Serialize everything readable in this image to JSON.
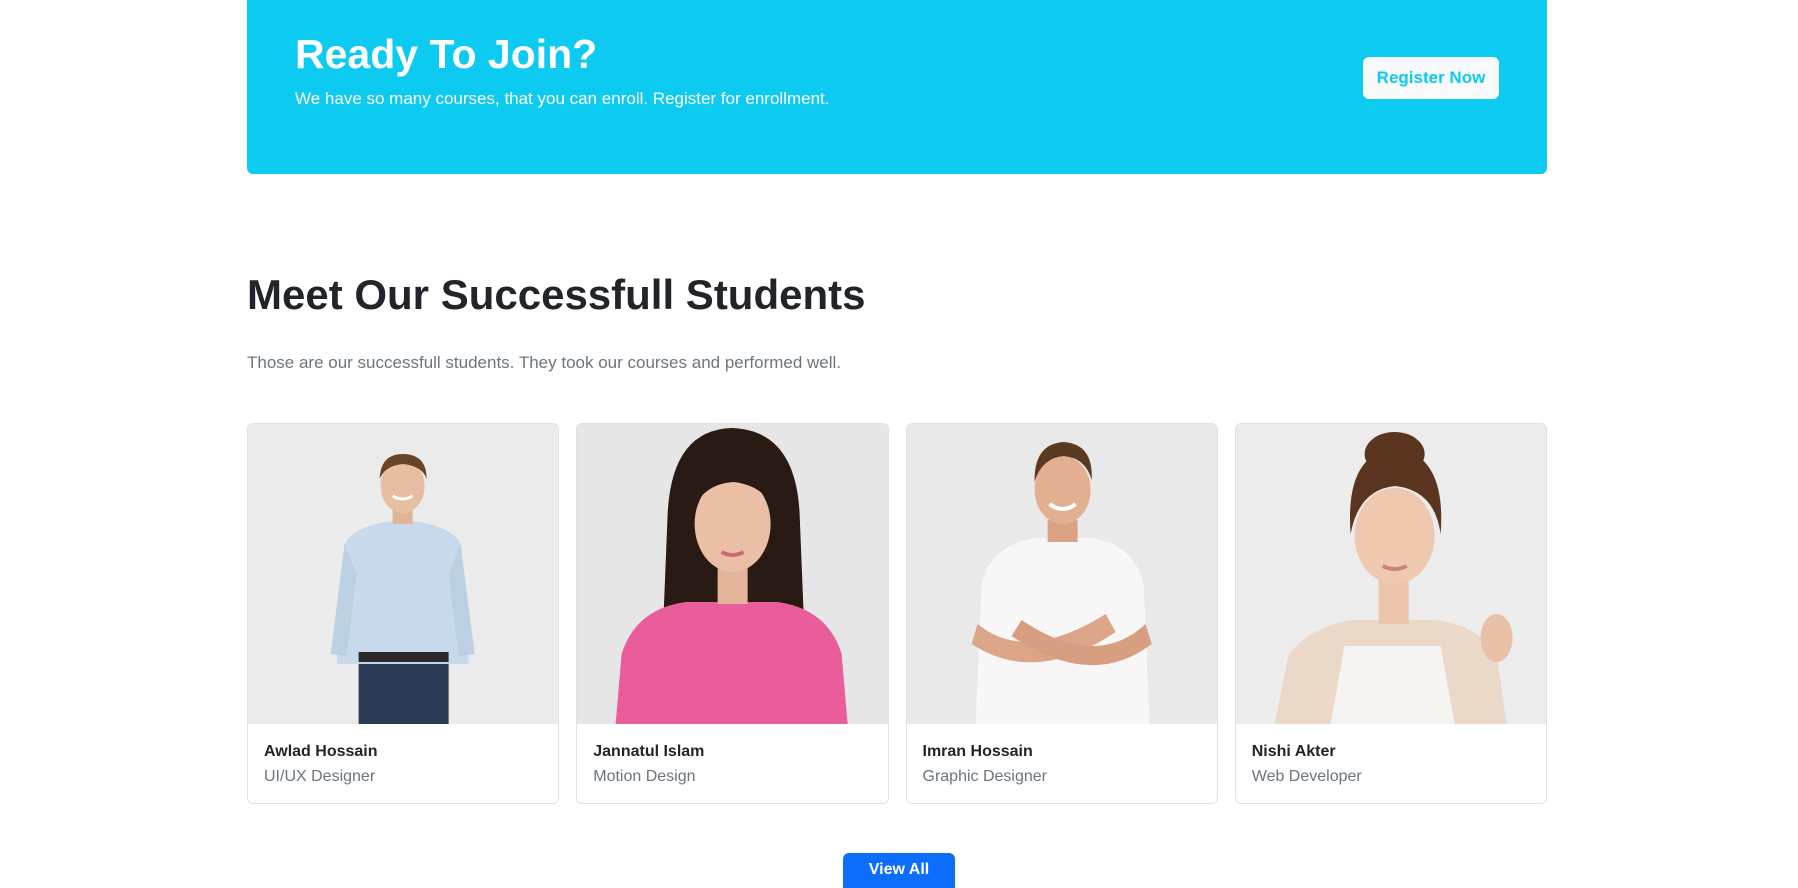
{
  "cta": {
    "title": "Ready To Join?",
    "subtitle": "We have so many courses, that you can enroll. Register for enrollment.",
    "button_label": "Register Now",
    "background": "#0dcaf0"
  },
  "students_section": {
    "title": "Meet Our Successfull Students",
    "subtitle": "Those are our successfull students. They took our courses and performed well.",
    "students": [
      {
        "name": "Awlad Hossain",
        "role": "UI/UX Designer"
      },
      {
        "name": "Jannatul Islam",
        "role": "Motion Design"
      },
      {
        "name": "Imran Hossain",
        "role": "Graphic Designer"
      },
      {
        "name": "Nishi Akter",
        "role": "Web Developer"
      }
    ],
    "view_all_label": "View All",
    "view_all_color": "#0d6efd"
  }
}
